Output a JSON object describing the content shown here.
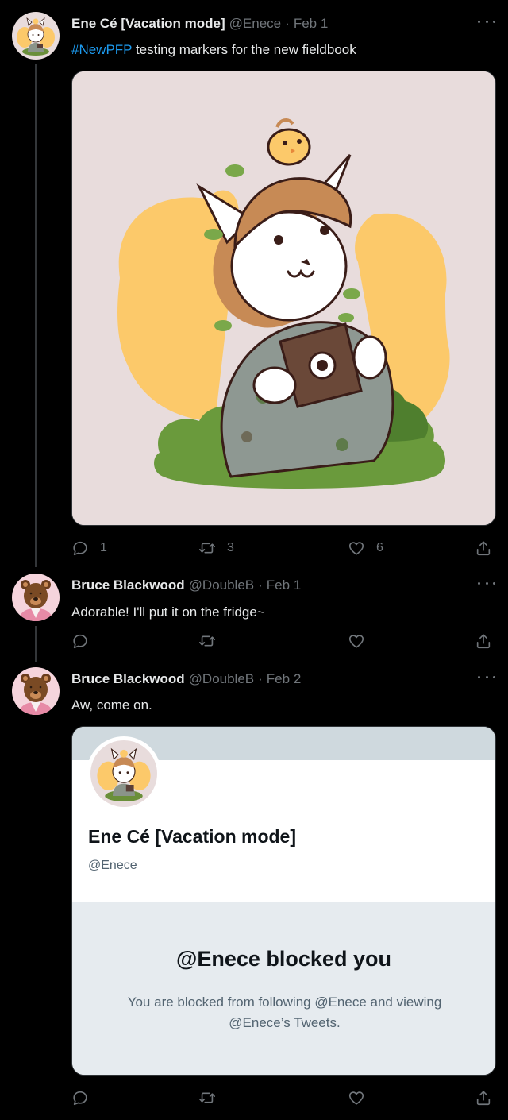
{
  "tweets": [
    {
      "name": "Ene Cé [Vacation mode]",
      "handle": "@Enece",
      "sep": "·",
      "date": "Feb 1",
      "hashtag": "#NewPFP",
      "text": " testing markers for the new fieldbook",
      "replies": "1",
      "retweets": "3",
      "likes": "6"
    },
    {
      "name": "Bruce Blackwood",
      "handle": "@DoubleB",
      "sep": "·",
      "date": "Feb 1",
      "text": "Adorable! I'll put it on the fridge~"
    },
    {
      "name": "Bruce Blackwood",
      "handle": "@DoubleB",
      "sep": "·",
      "date": "Feb 2",
      "text": "Aw, come on."
    }
  ],
  "card": {
    "name": "Ene Cé [Vacation mode]",
    "handle": "@Enece",
    "blocked_title": "@Enece blocked you",
    "blocked_desc": "You are blocked from following @Enece and viewing @Enece’s Tweets."
  },
  "icons": {
    "reply": "reply-icon",
    "retweet": "retweet-icon",
    "like": "heart-icon",
    "share": "share-icon",
    "more": "more-icon"
  },
  "colors": {
    "background": "#000000",
    "text": "#e7e9ea",
    "secondary": "#71767b",
    "link": "#1d9bf0"
  }
}
